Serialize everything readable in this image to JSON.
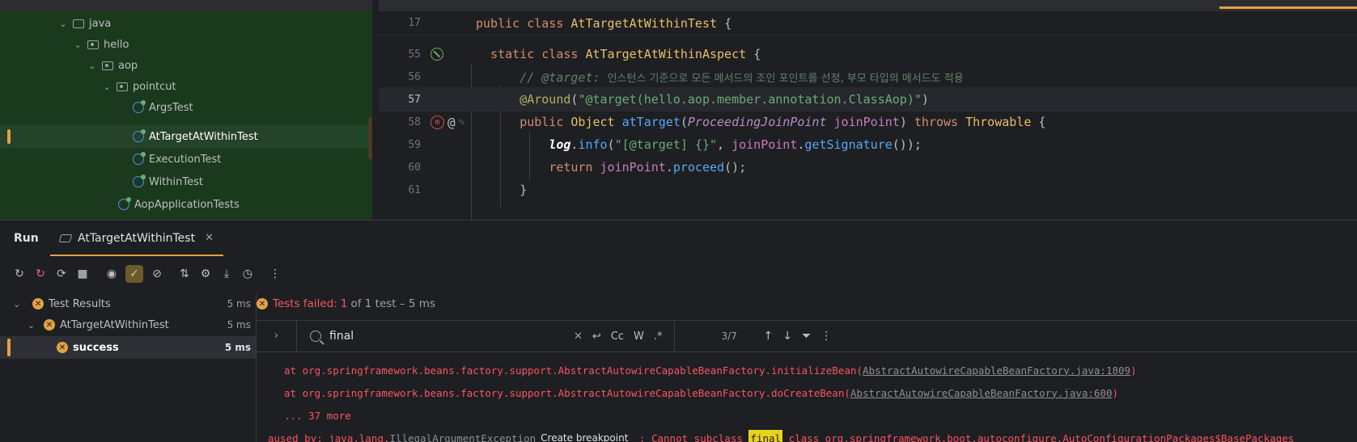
{
  "project_tree": {
    "items": [
      {
        "label": "java",
        "type": "folder"
      },
      {
        "label": "hello",
        "type": "package"
      },
      {
        "label": "aop",
        "type": "package"
      },
      {
        "label": "pointcut",
        "type": "package"
      },
      {
        "label": "ArgsTest",
        "type": "class"
      },
      {
        "label": "AtTargetAtWithinTest",
        "type": "class",
        "selected": true
      },
      {
        "label": "ExecutionTest",
        "type": "class"
      },
      {
        "label": "WithinTest",
        "type": "class"
      },
      {
        "label": "AopApplicationTests",
        "type": "class"
      }
    ]
  },
  "editor": {
    "sticky_line": {
      "number": "17",
      "kw1": "public",
      "kw2": "class",
      "name": "AtTargetAtWithinTest",
      "brace": "{"
    },
    "lines": [
      {
        "number": "55",
        "kw1": "static",
        "kw2": "class",
        "name": "AtTargetAtWithinAspect",
        "brace": "{"
      },
      {
        "number": "56",
        "comment_tag": "// @target:",
        "comment_text": "인스턴스 기준으로 모든 메서드의 조인 포인트를 선정, 부모 타입의 메서드도 적용"
      },
      {
        "number": "57",
        "annotation": "@Around",
        "paren_open": "(",
        "string": "\"@target(hello.aop.member.annotation.ClassAop)\"",
        "paren_close": ")"
      },
      {
        "number": "58",
        "kw1": "public",
        "type": "Object",
        "method": "atTarget",
        "paren_open": "(",
        "param_type": "ProceedingJoinPoint",
        "param_name": "joinPoint",
        "paren_close": ")",
        "throws": "throws",
        "exception": "Throwable",
        "brace": "{"
      },
      {
        "number": "59",
        "log": "log",
        "dot": ".",
        "call": "info",
        "arg_open": "(",
        "string": "\"[@target] {}\"",
        "comma": ", ",
        "var": "joinPoint",
        "dot2": ".",
        "call2": "getSignature",
        "end": "());"
      },
      {
        "number": "60",
        "kw1": "return",
        "var": "joinPoint",
        "dot": ".",
        "call": "proceed",
        "end": "();"
      },
      {
        "number": "61",
        "brace": "}"
      }
    ]
  },
  "run_panel": {
    "title": "Run",
    "tab_label": "AtTargetAtWithinTest",
    "results": [
      {
        "label": "Test Results",
        "time": "5 ms"
      },
      {
        "label": "AtTargetAtWithinTest",
        "time": "5 ms"
      },
      {
        "label": "success",
        "time": "5 ms",
        "selected": true
      }
    ],
    "status": {
      "fail": "Tests failed:",
      "count": "1",
      "rest": "of 1 test – 5 ms"
    },
    "search": {
      "value": "final",
      "options": [
        "Cc",
        "W",
        ".*"
      ],
      "match_count": "3/7"
    },
    "output": [
      {
        "prefix": "at org.springframework.beans.factory.support.AbstractAutowireCapableBeanFactory.initializeBean(",
        "link": "AbstractAutowireCapableBeanFactory.java:1809",
        "suffix": ")"
      },
      {
        "prefix": "at org.springframework.beans.factory.support.AbstractAutowireCapableBeanFactory.doCreateBean(",
        "link": "AbstractAutowireCapableBeanFactory.java:600",
        "suffix": ")"
      },
      {
        "text": "... 37 more"
      }
    ],
    "caused_by": {
      "prefix": "aused by: java.lang.",
      "link": "IllegalArgumentException",
      "breakpoint": "Create breakpoint",
      "mid": " : Cannot subclass ",
      "highlight": "final",
      "suffix": " class org.springframework.boot.autoconfigure.AutoConfigurationPackages$BasePackages"
    }
  },
  "colors": {
    "accent": "#e5a142",
    "error": "#f75464",
    "highlight": "#e8d21c"
  }
}
